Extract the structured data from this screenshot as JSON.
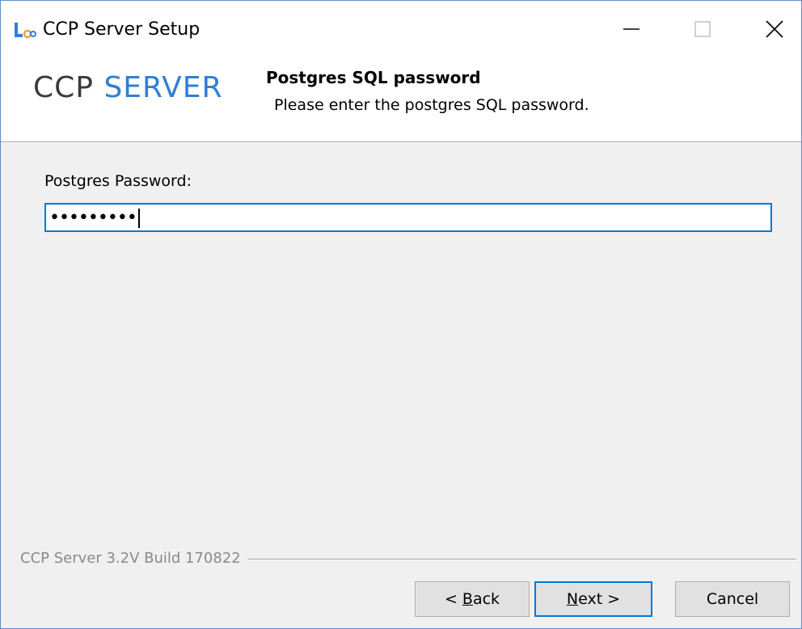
{
  "window": {
    "title": "CCP Server Setup",
    "app_icon": "ccp-app-icon",
    "controls": {
      "minimize_icon": "minimize-icon",
      "maximize_icon": "maximize-icon",
      "close_icon": "close-icon"
    }
  },
  "header": {
    "logo_ccp": "CCP",
    "logo_server": "SERVER",
    "step_title": "Postgres SQL password",
    "step_subtitle": "Please enter the postgres SQL password."
  },
  "form": {
    "password_label": "Postgres Password:",
    "password_value": "•••••••••"
  },
  "footer": {
    "build_text": "CCP Server 3.2V Build 170822",
    "back_prefix": "< ",
    "back_access": "B",
    "back_rest": "ack",
    "next_access": "N",
    "next_rest": "ext >",
    "cancel_label": "Cancel"
  },
  "colors": {
    "accent": "#0078d7",
    "logo_blue": "#2f7fd8",
    "window_border": "#5a8fc8"
  }
}
